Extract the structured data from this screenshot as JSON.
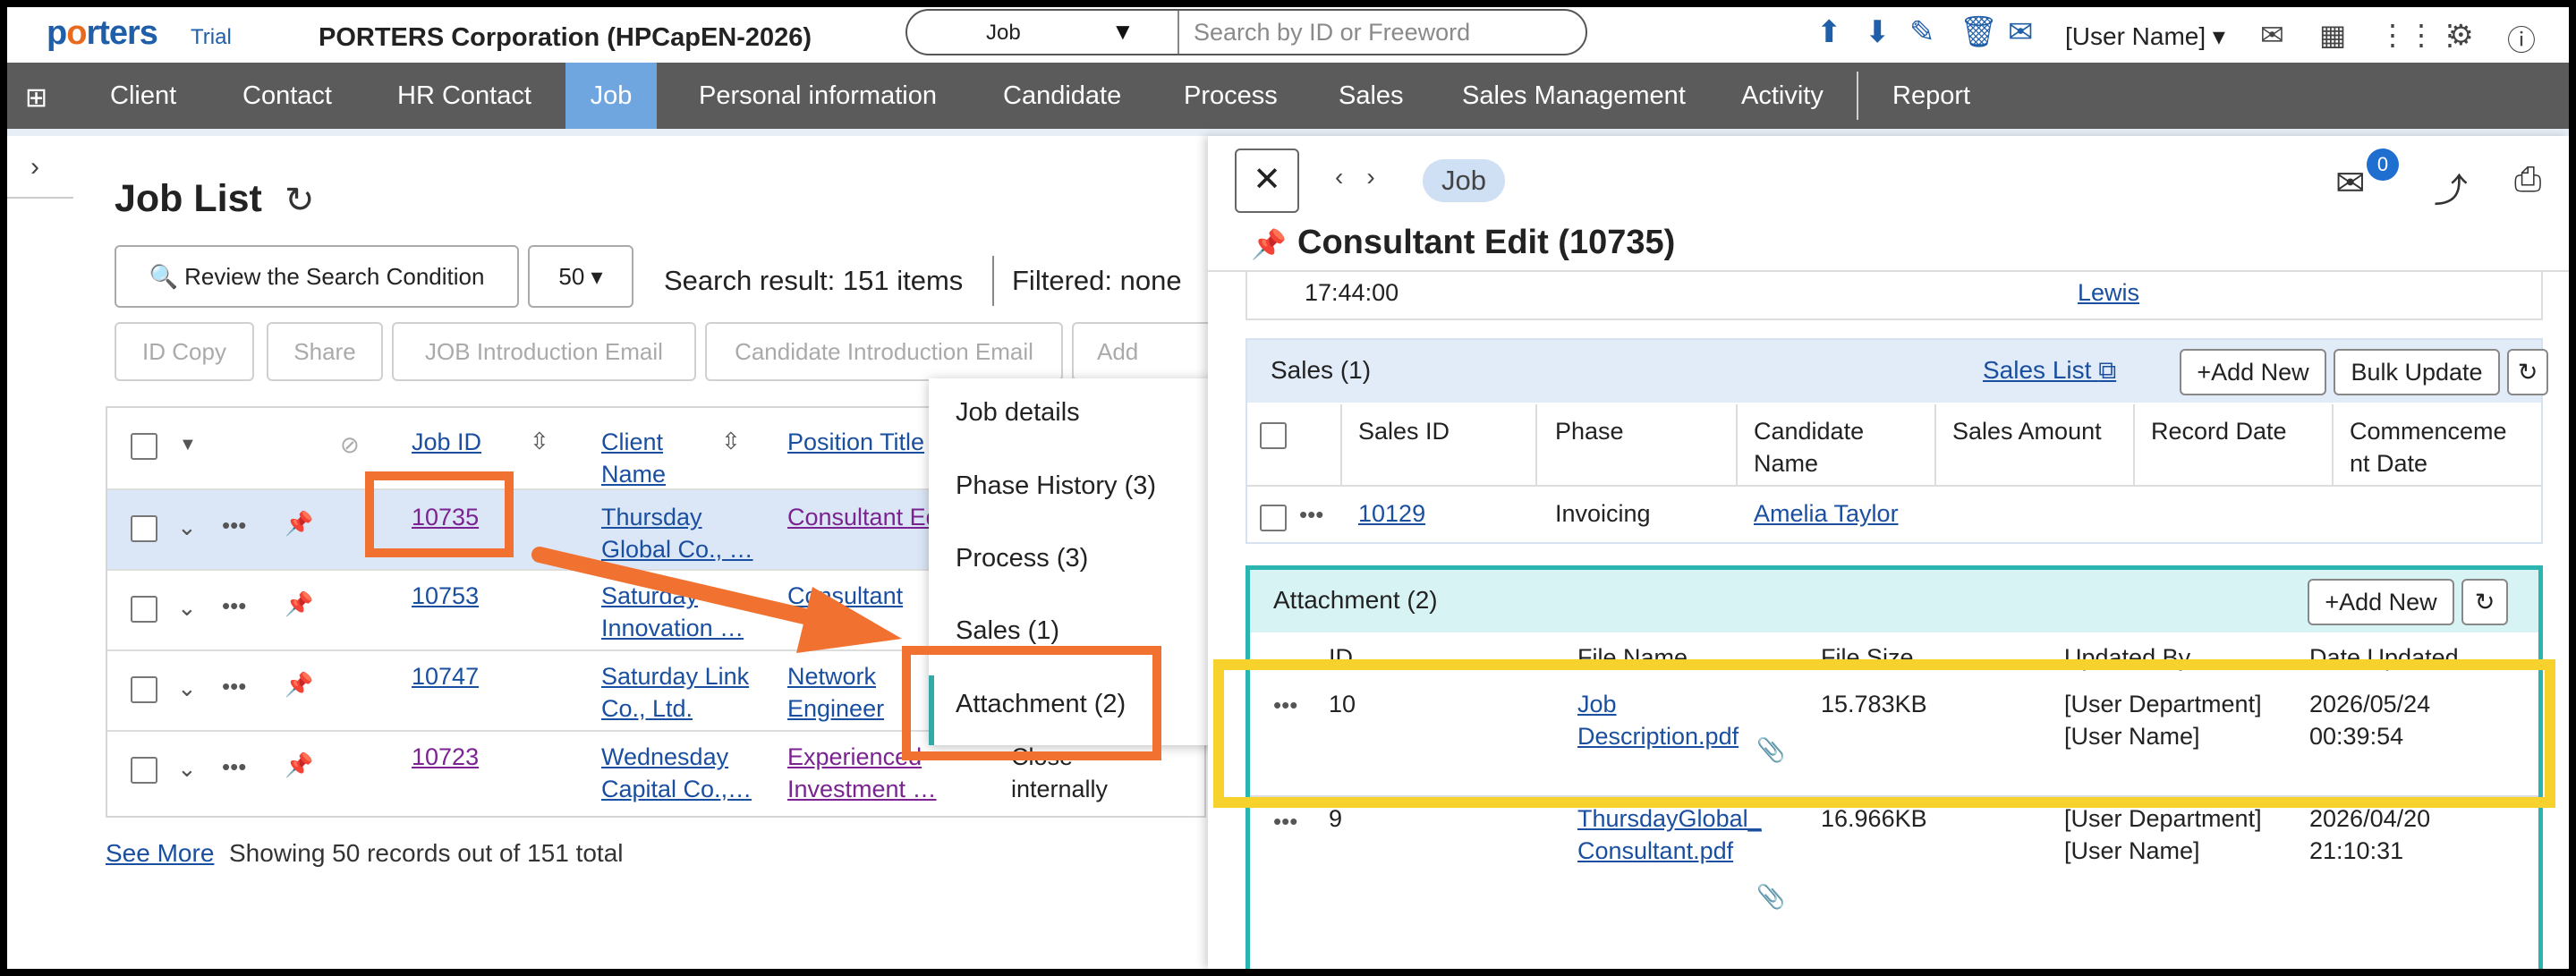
{
  "top": {
    "logo": "porters",
    "trial": "Trial",
    "company": "PORTERS Corporation (HPCapEN-2026)",
    "search_select": "Job",
    "search_placeholder": "Search by ID or Freeword",
    "user_name": "[User Name]"
  },
  "nav": {
    "items": [
      "Client",
      "Contact",
      "HR Contact",
      "Job",
      "Personal information",
      "Candidate",
      "Process",
      "Sales",
      "Sales Management",
      "Activity",
      "Report"
    ],
    "active": "Job"
  },
  "list": {
    "title": "Job List",
    "review_button": "Review the Search Condition",
    "page_size": "50",
    "search_result": "Search result: 151 items",
    "filtered": "Filtered: none",
    "actions": [
      "ID Copy",
      "Share",
      "JOB Introduction Email",
      "Candidate Introduction Email",
      "Add Proces"
    ],
    "columns": [
      "Job ID",
      "Client Name",
      "Position Title"
    ],
    "rows": [
      {
        "id": "10735",
        "client": "Thursday Global Co., …",
        "position": "Consultant Ed",
        "status": ""
      },
      {
        "id": "10753",
        "client": "Saturday Innovation …",
        "position": "Consultant",
        "status": ""
      },
      {
        "id": "10747",
        "client": "Saturday Link Co., Ltd.",
        "position": "Network Engineer",
        "status": ""
      },
      {
        "id": "10723",
        "client": "Wednesday Capital Co.,…",
        "position": "Experienced Investment …",
        "status": "Close internally"
      }
    ],
    "see_more": "See More",
    "records_total": "Showing 50 records out of 151 total"
  },
  "context_menu": {
    "items": [
      "Job details",
      "Phase History (3)",
      "Process (3)",
      "Sales (1)",
      "Attachment (2)"
    ]
  },
  "detail": {
    "pill": "Job",
    "mail_count": "0",
    "title": "Consultant Edit (10735)",
    "prev_time": "17:44:00",
    "prev_name": "Lewis",
    "sales": {
      "title": "Sales (1)",
      "list_link": "Sales List",
      "add_new": "+Add New",
      "bulk_update": "Bulk Update",
      "columns": [
        "Sales ID",
        "Phase",
        "Candidate Name",
        "Sales Amount",
        "Record Date",
        "Commencement Date"
      ],
      "rows": [
        {
          "id": "10129",
          "phase": "Invoicing",
          "candidate": "Amelia Taylor"
        }
      ]
    },
    "attachment": {
      "title": "Attachment (2)",
      "add_new": "+Add New",
      "columns": [
        "ID",
        "File Name",
        "File Size",
        "Updated By",
        "Date Updated"
      ],
      "rows": [
        {
          "id": "10",
          "file": "Job Description.pdf",
          "size": "15.783KB",
          "updated_by": "[User Department] [User Name]",
          "date": "2026/05/24 00:39:54"
        },
        {
          "id": "9",
          "file": "ThursdayGlobal_Consultant.pdf",
          "size": "16.966KB",
          "updated_by": "[User Department] [User Name]",
          "date": "2026/04/20 21:10:31"
        }
      ]
    }
  },
  "colors": {
    "nav_bg": "#5b5b5b",
    "nav_active": "#6fa6e0",
    "link": "#1a4fa0",
    "annotation_orange": "#f07130",
    "annotation_yellow": "#f7d12c",
    "attachment_border": "#2bb5b0"
  }
}
